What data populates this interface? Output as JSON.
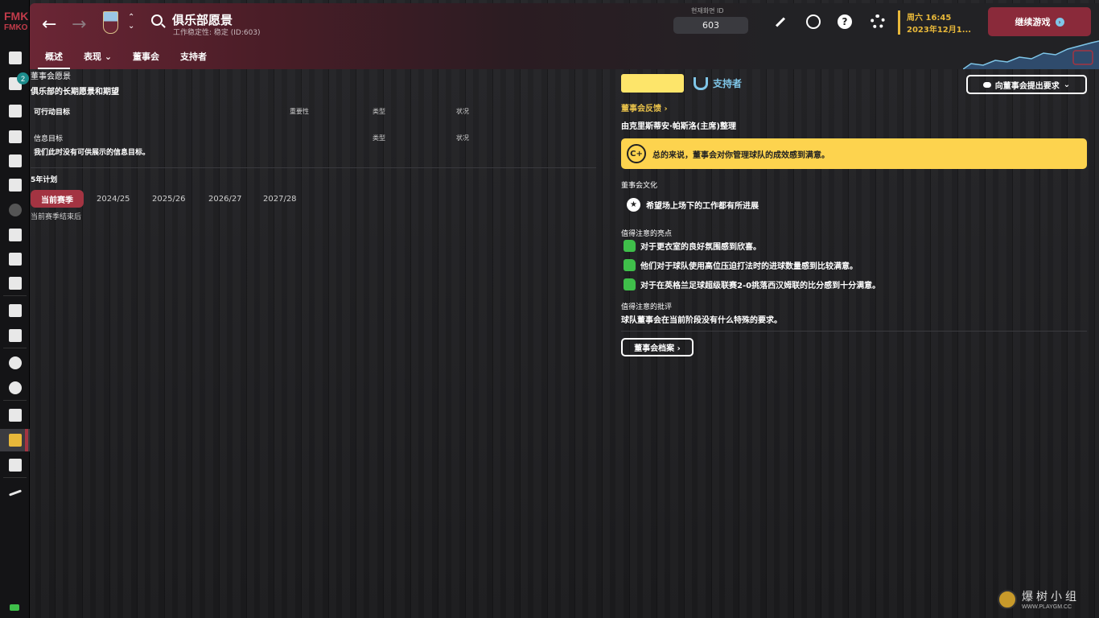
{
  "rail": {
    "logo_line1": "FMK",
    "logo_line2": "FMKO",
    "inbox_badge": "2"
  },
  "header": {
    "title": "俱乐部愿景",
    "subtitle": "工作稳定性: 稳定 (ID:603)",
    "tabs": [
      {
        "label": "概述"
      },
      {
        "label": "表现 ⌄"
      },
      {
        "label": "董事会"
      },
      {
        "label": "支持者"
      }
    ],
    "id_label": "현재화면 ID",
    "id_value": "603",
    "date_line1": "周六 16:45",
    "date_line2": "2023年12月1...",
    "continue_label": "继续游戏",
    "accent": "#8a2a3a"
  },
  "left": {
    "vision_title": "董事会愿景",
    "vision_subtitle": "俱乐部的长期愿景和期望",
    "actionable_label": "可行动目标",
    "col_importance": "重要性",
    "col_type": "类型",
    "col_status": "状况",
    "info_label": "信息目标",
    "info_col_type": "类型",
    "info_col_status": "状况",
    "info_empty": "我们此时没有可供展示的信息目标。",
    "plan_title": "5年计划",
    "plan_tabs": [
      "当前赛季",
      "2024/25",
      "2025/26",
      "2026/27",
      "2027/28"
    ],
    "plan_note": "当前赛季结束后"
  },
  "right": {
    "supporters_label": "支持者",
    "request_button": "向董事会提出要求",
    "feedback_link": "董事会反馈 ›",
    "byline": "由克里斯蒂安·帕斯洛(主席)整理",
    "grade": "C+",
    "verdict": "总的来说，董事会对你管理球队的成效感到满意。",
    "culture_title": "董事会文化",
    "culture_item": "希望场上场下的工作都有所进展",
    "highlights_title": "值得注意的亮点",
    "highlights": [
      "对于更衣室的良好氛围感到欣喜。",
      "他们对于球队使用高位压迫打法时的进球数量感到比较满意。",
      "对于在英格兰足球超级联赛2-0挑落西汉姆联的比分感到十分满意。"
    ],
    "criticism_title": "值得注意的批评",
    "criticism_text": "球队董事会在当前阶段没有什么特殊的要求。",
    "archive_button": "董事会档案 ›"
  },
  "watermark": {
    "text": "爆树小组",
    "url": "WWW.PLAYGM.CC"
  }
}
